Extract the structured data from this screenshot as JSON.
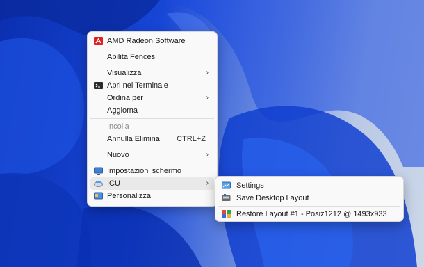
{
  "context_menu": {
    "items": [
      {
        "label": "AMD Radeon Software",
        "icon": "amd-radeon-icon"
      },
      {
        "label": "Abilita Fences"
      },
      {
        "label": "Visualizza",
        "submenu": true
      },
      {
        "label": "Apri nel Terminale",
        "icon": "terminal-icon"
      },
      {
        "label": "Ordina per",
        "submenu": true
      },
      {
        "label": "Aggiorna"
      },
      {
        "label": "Incolla",
        "disabled": true
      },
      {
        "label": "Annulla Elimina",
        "shortcut": "CTRL+Z"
      },
      {
        "label": "Nuovo",
        "submenu": true
      },
      {
        "label": "Impostazioni schermo",
        "icon": "display-icon"
      },
      {
        "label": "ICU",
        "icon": "icu-icon",
        "submenu": true,
        "highlighted": true
      },
      {
        "label": "Personalizza",
        "icon": "personalize-icon"
      }
    ]
  },
  "icu_submenu": {
    "items": [
      {
        "label": "Settings",
        "icon": "settings-icon"
      },
      {
        "label": "Save Desktop Layout",
        "icon": "save-layout-icon"
      },
      {
        "label": "Restore Layout #1 - Posiz1212 @ 1493x933",
        "icon": "restore-layout-icon"
      }
    ]
  },
  "glyphs": {
    "chevron": "›"
  },
  "colors": {
    "amd_red": "#e02020",
    "desktop_blue": "#1746d6"
  }
}
